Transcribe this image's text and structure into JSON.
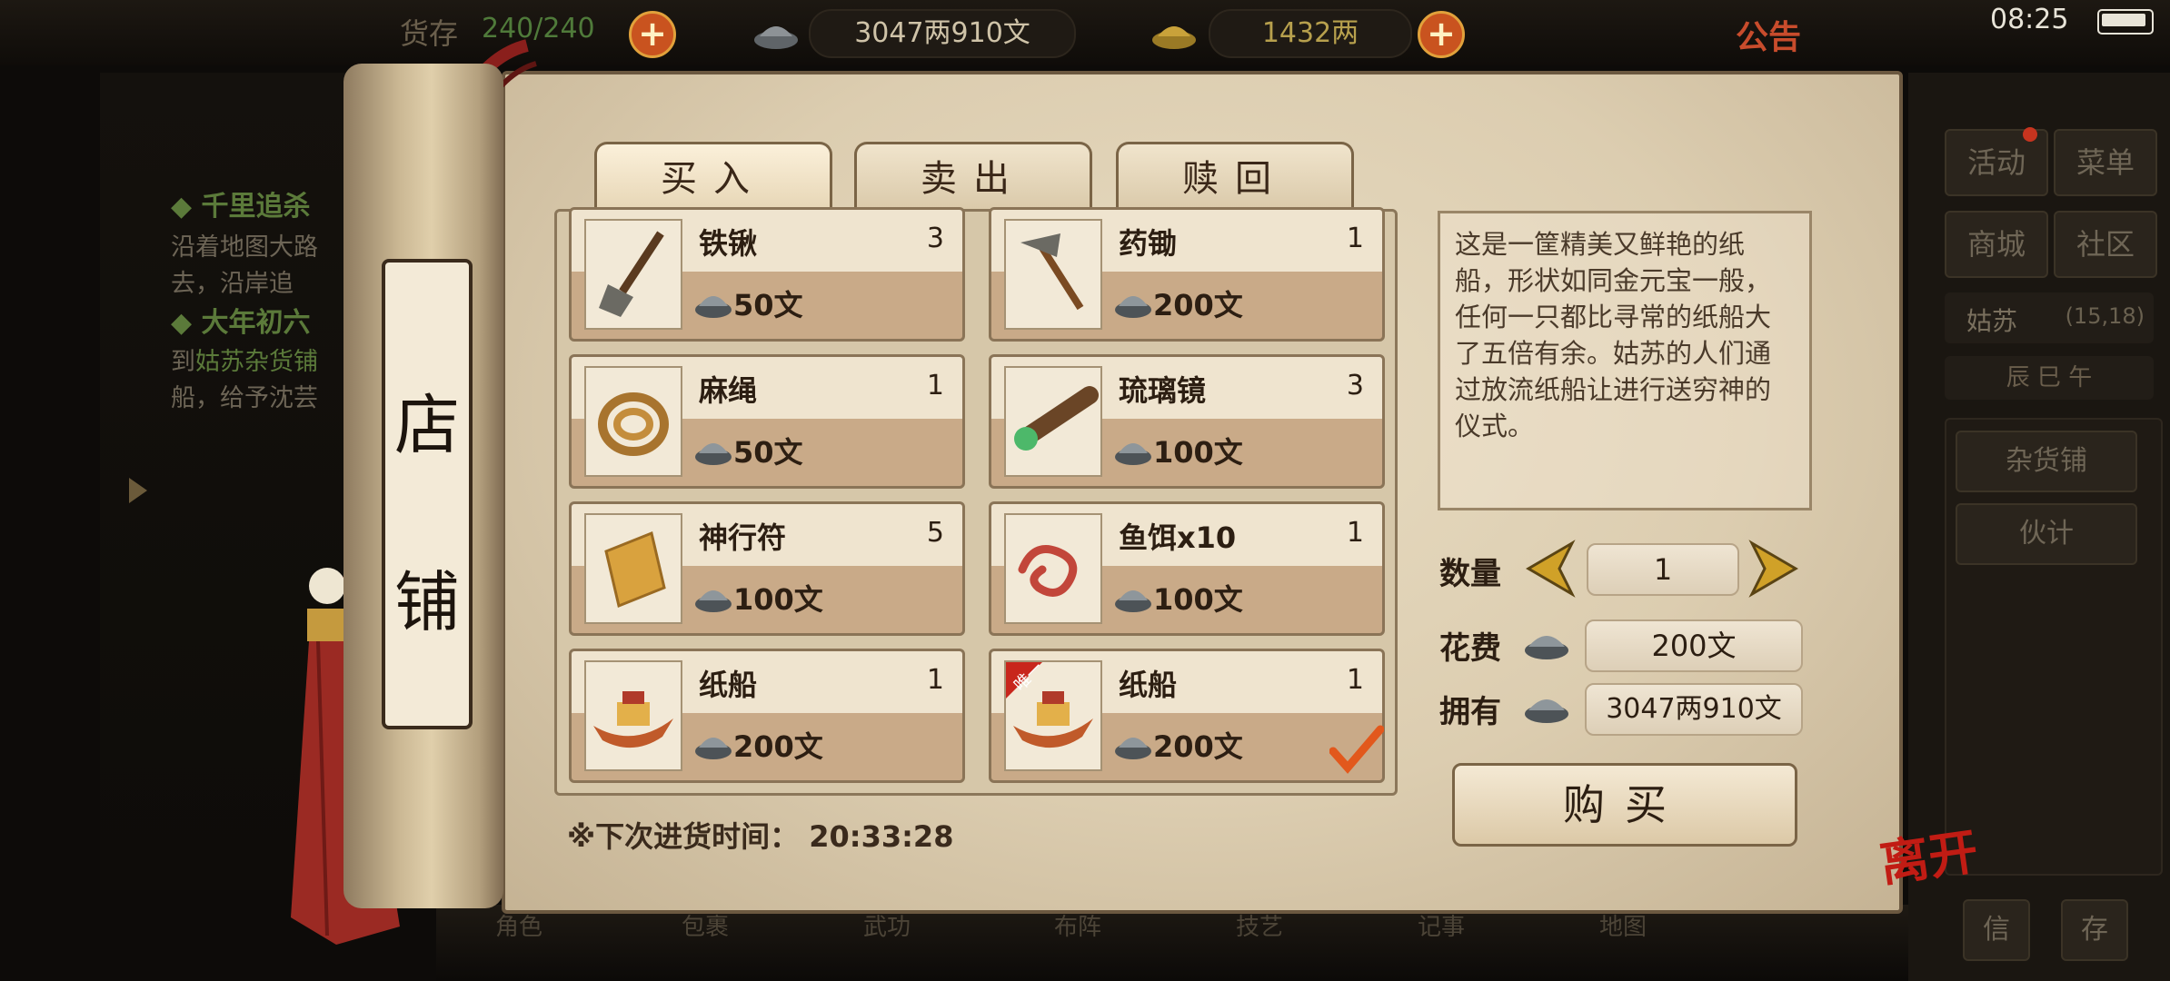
{
  "topbar": {
    "bag_label": "货存",
    "bag_value": "240/240",
    "silver_value": "3047两910文",
    "gold_value": "1432两",
    "notice_label": "公告",
    "time": "08:25"
  },
  "right_menu": {
    "activity": "活动",
    "menu": "菜单",
    "mall": "商城",
    "community": "社区",
    "location_name": "姑苏",
    "location_coord": "(15,18)",
    "shichen": "辰 巳 午",
    "grocery": "杂货铺",
    "assistant": "伙计",
    "btn_a": "信",
    "btn_b": "存"
  },
  "quests": [
    {
      "title": "千里追杀",
      "lines": [
        "沿着地图大路",
        "去，沿岸追"
      ]
    },
    {
      "title": "大年初六",
      "lines_prefix": "到",
      "lines_link": "姑苏杂货铺",
      "line2": "船，给予沈芸"
    }
  ],
  "scroll_title": [
    "店",
    "铺"
  ],
  "tabs": [
    {
      "label": "买入",
      "active": true
    },
    {
      "label": "卖出",
      "active": false
    },
    {
      "label": "赎回",
      "active": false
    }
  ],
  "items": [
    {
      "name": "铁锹",
      "count": "3",
      "price": "50文",
      "icon": "shovel-icon"
    },
    {
      "name": "药锄",
      "count": "1",
      "price": "200文",
      "icon": "hoe-icon"
    },
    {
      "name": "麻绳",
      "count": "1",
      "price": "50文",
      "icon": "rope-icon"
    },
    {
      "name": "琉璃镜",
      "count": "3",
      "price": "100文",
      "icon": "telescope-icon"
    },
    {
      "name": "神行符",
      "count": "5",
      "price": "100文",
      "icon": "talisman-icon"
    },
    {
      "name": "鱼饵x10",
      "count": "1",
      "price": "100文",
      "icon": "worm-icon"
    },
    {
      "name": "纸船",
      "count": "1",
      "price": "200文",
      "icon": "paper-boat-icon"
    },
    {
      "name": "纸船",
      "count": "1",
      "price": "200文",
      "icon": "paper-boat-icon",
      "badge": "唯一",
      "selected": true
    }
  ],
  "description": "这是一筐精美又鲜艳的纸船，形状如同金元宝一般，任何一只都比寻常的纸船大了五倍有余。姑苏的人们通过放流纸船让进行送穷神的仪式。",
  "purchase": {
    "qty_label": "数量",
    "qty_value": "1",
    "cost_label": "花费",
    "cost_value": "200文",
    "own_label": "拥有",
    "own_value": "3047两910文",
    "buy_label": "购买"
  },
  "restock_label": "※下次进货时间：",
  "restock_time": "20:33:28",
  "leave_label": "离开",
  "bottom_nav": [
    "角色",
    "包裹",
    "武功",
    "布阵",
    "技艺",
    "记事",
    "地图"
  ]
}
